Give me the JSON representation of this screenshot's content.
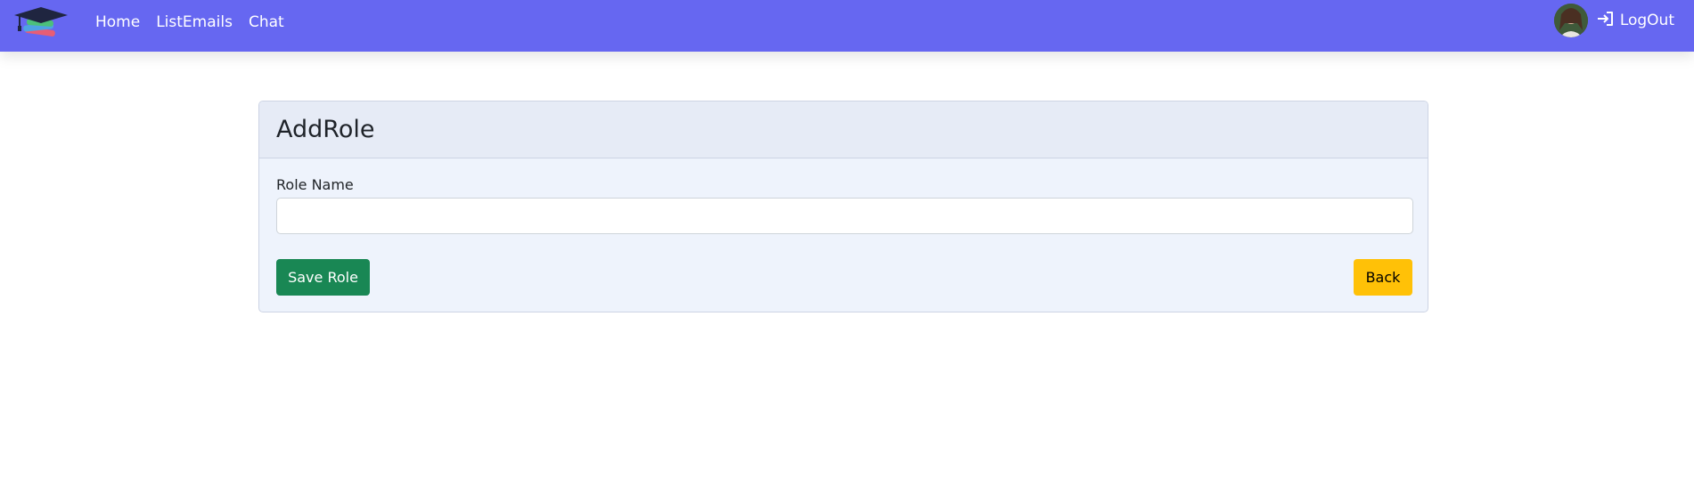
{
  "colors": {
    "navbar": "#6667f1",
    "card_body": "#eef3fc",
    "card_header": "#e6ebf6",
    "save_button": "#198754",
    "back_button": "#ffc107"
  },
  "navbar": {
    "logo_icon": "graduation-cap-books-icon",
    "links": [
      {
        "label": "Home"
      },
      {
        "label": "ListEmails"
      },
      {
        "label": "Chat"
      }
    ],
    "avatar_icon": "user-avatar",
    "logout": {
      "icon": "sign-in-arrow-icon",
      "label": "LogOut"
    }
  },
  "form": {
    "title": "AddRole",
    "role_name_label": "Role Name",
    "role_name_value": "",
    "role_name_placeholder": "",
    "save_label": "Save Role",
    "back_label": "Back"
  }
}
